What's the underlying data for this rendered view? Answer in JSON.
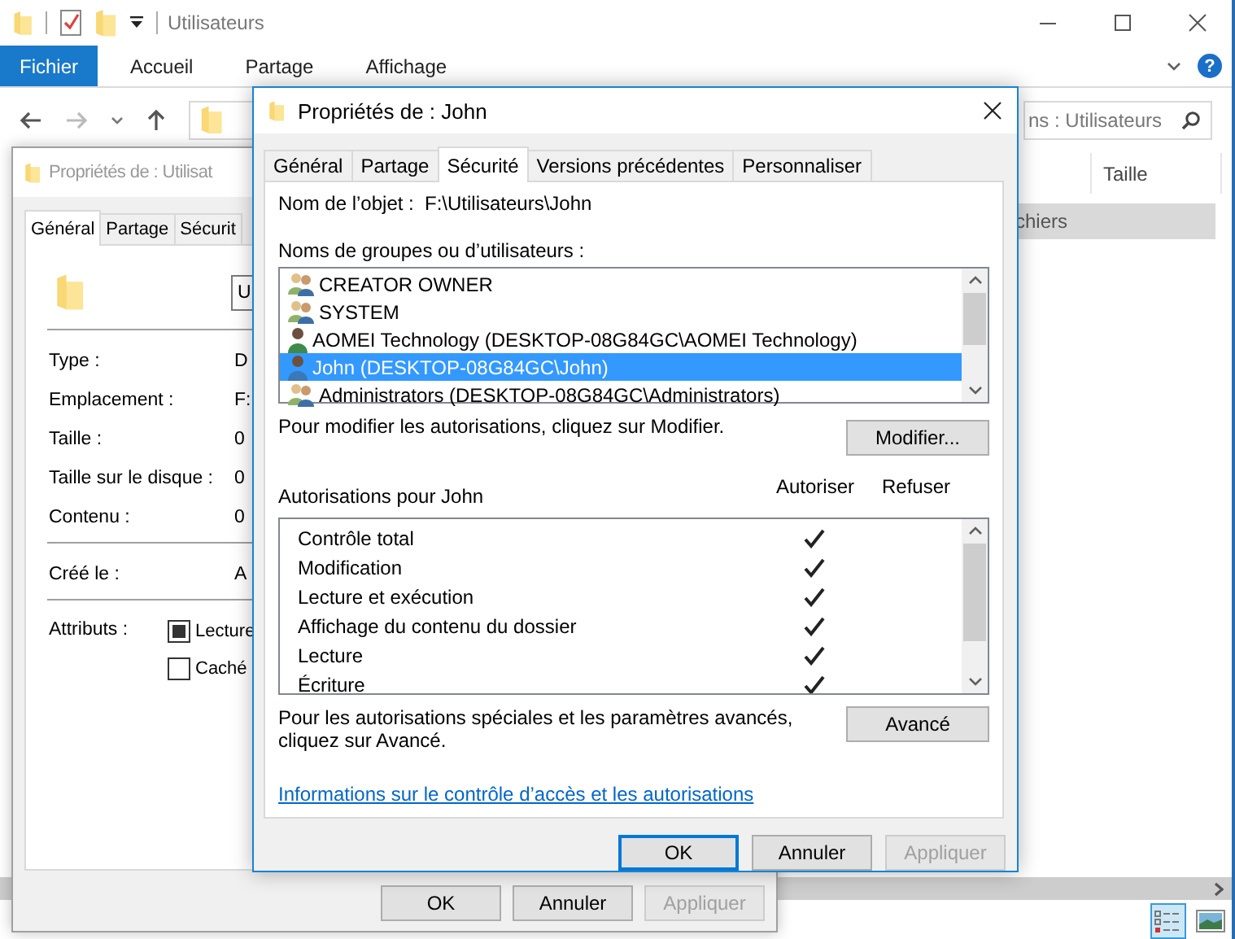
{
  "explorer": {
    "title": "Utilisateurs",
    "ribbon_tabs": [
      {
        "label": "Fichier",
        "selected": true
      },
      {
        "label": "Accueil",
        "selected": false
      },
      {
        "label": "Partage",
        "selected": false
      },
      {
        "label": "Affichage",
        "selected": false
      }
    ],
    "help": "?",
    "search": {
      "placeholder": "ns : Utilisateurs"
    },
    "columns": [
      "Taille"
    ],
    "rows": [
      {
        "label": "chiers",
        "selected": true
      }
    ],
    "views": [
      {
        "kind": "details",
        "selected": true
      },
      {
        "kind": "large-icons",
        "selected": false
      }
    ]
  },
  "back_dialog": {
    "title": "Propriétés de : Utilisat",
    "tabs": [
      {
        "label": "Général",
        "selected": true
      },
      {
        "label": "Partage",
        "selected": false
      },
      {
        "label": "Sécurit",
        "selected": false
      }
    ],
    "name_value": "U",
    "sections": [
      [
        {
          "label": "Type :",
          "value": "D"
        },
        {
          "label": "Emplacement :",
          "value": "F:"
        },
        {
          "label": "Taille :",
          "value": "0"
        },
        {
          "label": "Taille sur le disque :",
          "value": "0"
        },
        {
          "label": "Contenu :",
          "value": "0"
        }
      ],
      [
        {
          "label": "Créé le :",
          "value": "A"
        }
      ]
    ],
    "attributes_label": "Attributs :",
    "attributes": [
      {
        "label": "Lecture",
        "indeterminate": true
      },
      {
        "label": "Caché",
        "indeterminate": false
      }
    ],
    "buttons": [
      {
        "label": "OK",
        "disabled": false
      },
      {
        "label": "Annuler",
        "disabled": false
      },
      {
        "label": "Appliquer",
        "disabled": true
      }
    ]
  },
  "dialog": {
    "title": "Propriétés de : John",
    "tabs": [
      {
        "label": "Général",
        "selected": false
      },
      {
        "label": "Partage",
        "selected": false
      },
      {
        "label": "Sécurité",
        "selected": true
      },
      {
        "label": "Versions précédentes",
        "selected": false
      },
      {
        "label": "Personnaliser",
        "selected": false
      }
    ],
    "object_label": "Nom de l’objet :",
    "object_value": "F:\\Utilisateurs\\John",
    "principals_label": "Noms de groupes ou d’utilisateurs :",
    "principals": [
      {
        "kind": "group",
        "name": "CREATOR OWNER",
        "selected": false
      },
      {
        "kind": "group",
        "name": "SYSTEM",
        "selected": false
      },
      {
        "kind": "user",
        "name": "AOMEI Technology (DESKTOP-08G84GC\\AOMEI Technology)",
        "selected": false,
        "color": "#3f8a4a"
      },
      {
        "kind": "user",
        "name": "John (DESKTOP-08G84GC\\John)",
        "selected": true,
        "color": "#3a78b8"
      },
      {
        "kind": "group",
        "name": "Administrators (DESKTOP-08G84GC\\Administrators)",
        "selected": false
      }
    ],
    "modify_hint": "Pour modifier les autorisations, cliquez sur Modifier.",
    "modify_button": "Modifier...",
    "permissions_label": "Autorisations pour John",
    "permission_columns": [
      "Autoriser",
      "Refuser"
    ],
    "permissions": [
      {
        "name": "Contrôle total",
        "allow": true,
        "deny": false
      },
      {
        "name": "Modification",
        "allow": true,
        "deny": false
      },
      {
        "name": "Lecture et exécution",
        "allow": true,
        "deny": false
      },
      {
        "name": "Affichage du contenu du dossier",
        "allow": true,
        "deny": false
      },
      {
        "name": "Lecture",
        "allow": true,
        "deny": false
      },
      {
        "name": "Écriture",
        "allow": true,
        "deny": false
      }
    ],
    "advanced_hint": "Pour les autorisations spéciales et les paramètres avancés, cliquez sur Avancé.",
    "advanced_button": "Avancé",
    "link": "Informations sur le contrôle d’accès et les autorisations",
    "buttons": [
      {
        "label": "OK",
        "disabled": false,
        "default": true
      },
      {
        "label": "Annuler",
        "disabled": false,
        "default": false
      },
      {
        "label": "Appliquer",
        "disabled": true,
        "default": false
      }
    ]
  }
}
